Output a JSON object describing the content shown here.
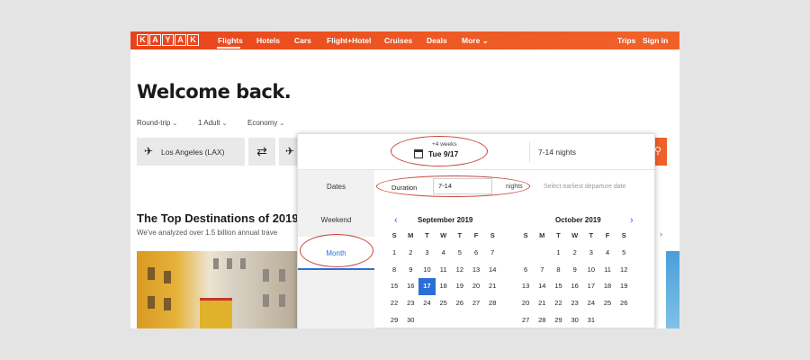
{
  "nav": {
    "logo_letters": [
      "K",
      "A",
      "Y",
      "A",
      "K"
    ],
    "links": [
      "Flights",
      "Hotels",
      "Cars",
      "Flight+Hotel",
      "Cruises",
      "Deals",
      "More ⌄"
    ],
    "trips": "Trips",
    "signin": "Sign in"
  },
  "welcome": "Welcome back.",
  "options": {
    "trip_type": "Round-trip",
    "adults": "1 Adult",
    "cabin": "Economy"
  },
  "search": {
    "origin": "Los Angeles (LAX)"
  },
  "destinations": {
    "title": "The Top Destinations of 2019",
    "subtitle": "We've analyzed over 1.5 billion annual trave"
  },
  "popup": {
    "flex_sub": "+4 weeks",
    "flex_date": "Tue 9/17",
    "nights_head": "7-14 nights",
    "tabs": [
      "Dates",
      "Weekend",
      "Month"
    ],
    "duration_label": "Duration",
    "duration_value": "7-14",
    "nights_label": "nights",
    "departure_hint": "Select earliest departure date",
    "weekdays": [
      "S",
      "M",
      "T",
      "W",
      "T",
      "F",
      "S"
    ],
    "months": [
      {
        "title": "September 2019",
        "weeks": [
          [
            "1",
            "2",
            "3",
            "4",
            "5",
            "6",
            "7"
          ],
          [
            "8",
            "9",
            "10",
            "11",
            "12",
            "13",
            "14"
          ],
          [
            "15",
            "16",
            "17",
            "18",
            "19",
            "20",
            "21"
          ],
          [
            "22",
            "23",
            "24",
            "25",
            "26",
            "27",
            "28"
          ],
          [
            "29",
            "30",
            "",
            "",
            "",
            "",
            ""
          ]
        ],
        "selected": "17"
      },
      {
        "title": "October 2019",
        "weeks": [
          [
            "",
            "",
            "1",
            "2",
            "3",
            "4",
            "5"
          ],
          [
            "6",
            "7",
            "8",
            "9",
            "10",
            "11",
            "12"
          ],
          [
            "13",
            "14",
            "15",
            "16",
            "17",
            "18",
            "19"
          ],
          [
            "20",
            "21",
            "22",
            "23",
            "24",
            "25",
            "26"
          ],
          [
            "27",
            "28",
            "29",
            "30",
            "31",
            "",
            ""
          ]
        ],
        "selected": ""
      }
    ]
  },
  "colors": {
    "brand": "#ee5a24",
    "accent": "#2b6fd6",
    "annotation": "#c9473b"
  },
  "icons": {
    "plane": "airplane-icon",
    "swap": "swap-arrows-icon",
    "calendar": "calendar-icon",
    "search": "search-icon"
  }
}
